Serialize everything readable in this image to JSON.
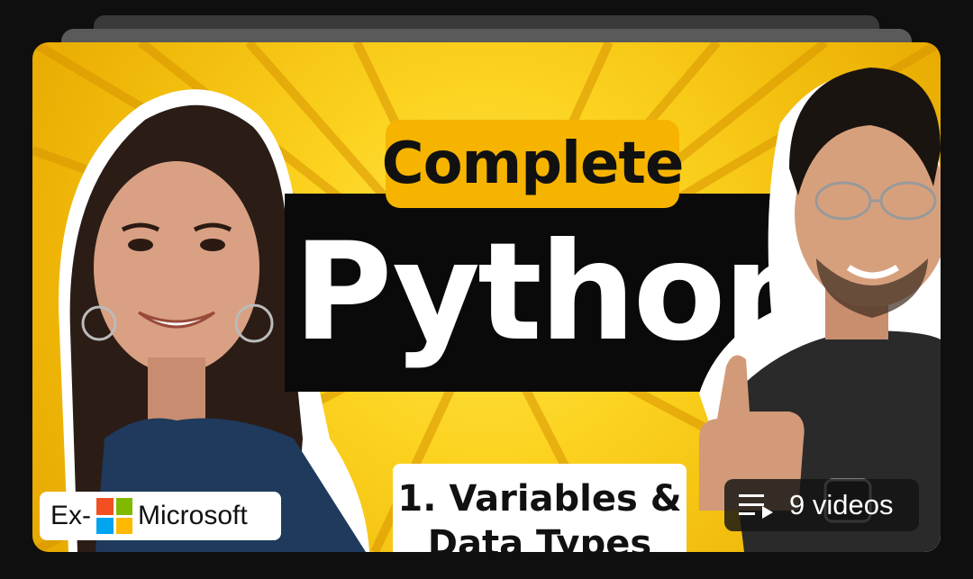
{
  "thumbnail": {
    "headline_top": "Complete",
    "headline_main": "Python",
    "lesson_line_1": "1. Variables &",
    "lesson_line_2": "Data Types",
    "badge": {
      "prefix": "Ex-",
      "company": "Microsoft",
      "icon": "microsoft-logo-icon"
    },
    "playlist": {
      "icon": "playlist-icon",
      "count_label": "9 videos"
    }
  },
  "colors": {
    "accent_yellow": "#fcd320",
    "pill_orange": "#f6b400",
    "band_black": "#0a0a0a",
    "page_bg": "#0f0f0f"
  }
}
